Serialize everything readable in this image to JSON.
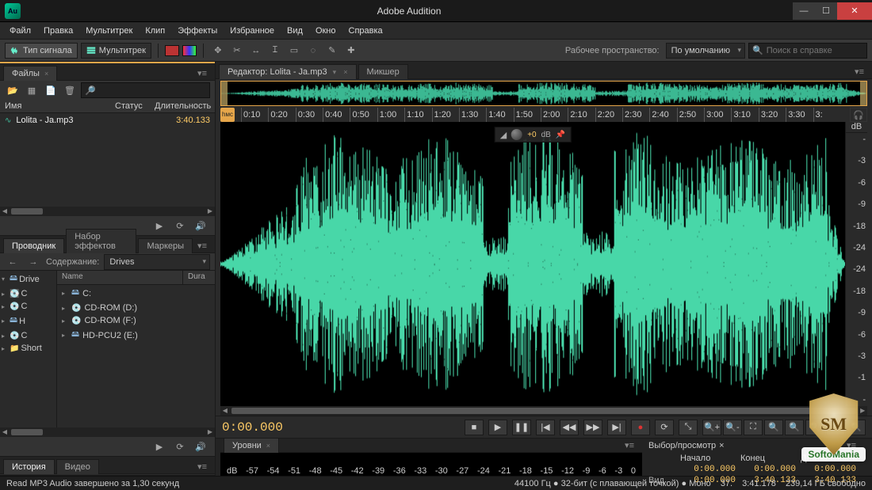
{
  "title": "Adobe Audition",
  "app_icon": "Au",
  "menu": [
    "Файл",
    "Правка",
    "Мультитрек",
    "Клип",
    "Эффекты",
    "Избранное",
    "Вид",
    "Окно",
    "Справка"
  ],
  "toolbar": {
    "waveform": "Тип сигнала",
    "multitrack": "Мультитрек",
    "workspace_label": "Рабочее пространство:",
    "workspace": "По умолчанию",
    "search_placeholder": "Поиск в справке"
  },
  "files_panel": {
    "tab": "Файлы",
    "cols": {
      "name": "Имя",
      "status": "Статус",
      "duration": "Длительность"
    },
    "items": [
      {
        "name": "Lolita - Ja.mp3",
        "duration": "3:40.133"
      }
    ]
  },
  "browser_panel": {
    "tabs": [
      "Проводник",
      "Набор эффектов",
      "Маркеры"
    ],
    "content_label": "Содержание:",
    "content_value": "Drives",
    "cols": {
      "name": "Name",
      "dur": "Dura"
    },
    "tree": [
      {
        "label": "Drive"
      },
      {
        "label": "C"
      },
      {
        "label": "C"
      },
      {
        "label": "H"
      },
      {
        "label": "C"
      },
      {
        "label": "Short"
      }
    ],
    "list": [
      {
        "label": "C:"
      },
      {
        "label": "CD-ROM (D:)"
      },
      {
        "label": "CD-ROM (F:)"
      },
      {
        "label": "HD-PCU2 (E:)"
      }
    ]
  },
  "history_panel": {
    "tabs": [
      "История",
      "Видео"
    ]
  },
  "editor": {
    "tab_label": "Редактор: Lolita - Ja.mp3",
    "mixer_tab": "Микшер",
    "ruler_start": "hмс",
    "ticks": [
      "0:10",
      "0:20",
      "0:30",
      "0:40",
      "0:50",
      "1:00",
      "1:10",
      "1:20",
      "1:30",
      "1:40",
      "1:50",
      "2:00",
      "2:10",
      "2:20",
      "2:30",
      "2:40",
      "2:50",
      "3:00",
      "3:10",
      "3:20",
      "3:30",
      "3:"
    ],
    "hud_value": "+0",
    "hud_unit": "dB",
    "db_header": "dB",
    "db_marks": [
      "-",
      "-3",
      "-6",
      "-9",
      "-18",
      "-24",
      "-24",
      "-18",
      "-9",
      "-6",
      "-3",
      "-1",
      "-"
    ]
  },
  "transport": {
    "timecode": "0:00.000"
  },
  "levels": {
    "tab": "Уровни",
    "marks": [
      "dB",
      "-57",
      "-54",
      "-51",
      "-48",
      "-45",
      "-42",
      "-39",
      "-36",
      "-33",
      "-30",
      "-27",
      "-24",
      "-21",
      "-18",
      "-15",
      "-12",
      "-9",
      "-6",
      "-3",
      "0"
    ]
  },
  "selection": {
    "title": "Выбор/просмотр",
    "headers": {
      "start": "Начало",
      "end": "Конец",
      "dur": "Длительность"
    },
    "rows": [
      {
        "label": "",
        "start": "0:00.000",
        "end": "0:00.000",
        "dur": "0:00.000"
      },
      {
        "label": "Вид",
        "start": "0:00.000",
        "end": "3:40.133",
        "dur": "3:40.133"
      }
    ]
  },
  "status": {
    "msg": "Read MP3 Audio завершено за 1,30 секунд",
    "audio": "44100 Гц ● 32-бит (с плавающей точкой) ● Моно",
    "size": "37.",
    "dur": "3:41.178",
    "free": "239,14 ГБ свободно"
  },
  "watermark": {
    "badge": "SM",
    "text": "SoftoMania"
  }
}
